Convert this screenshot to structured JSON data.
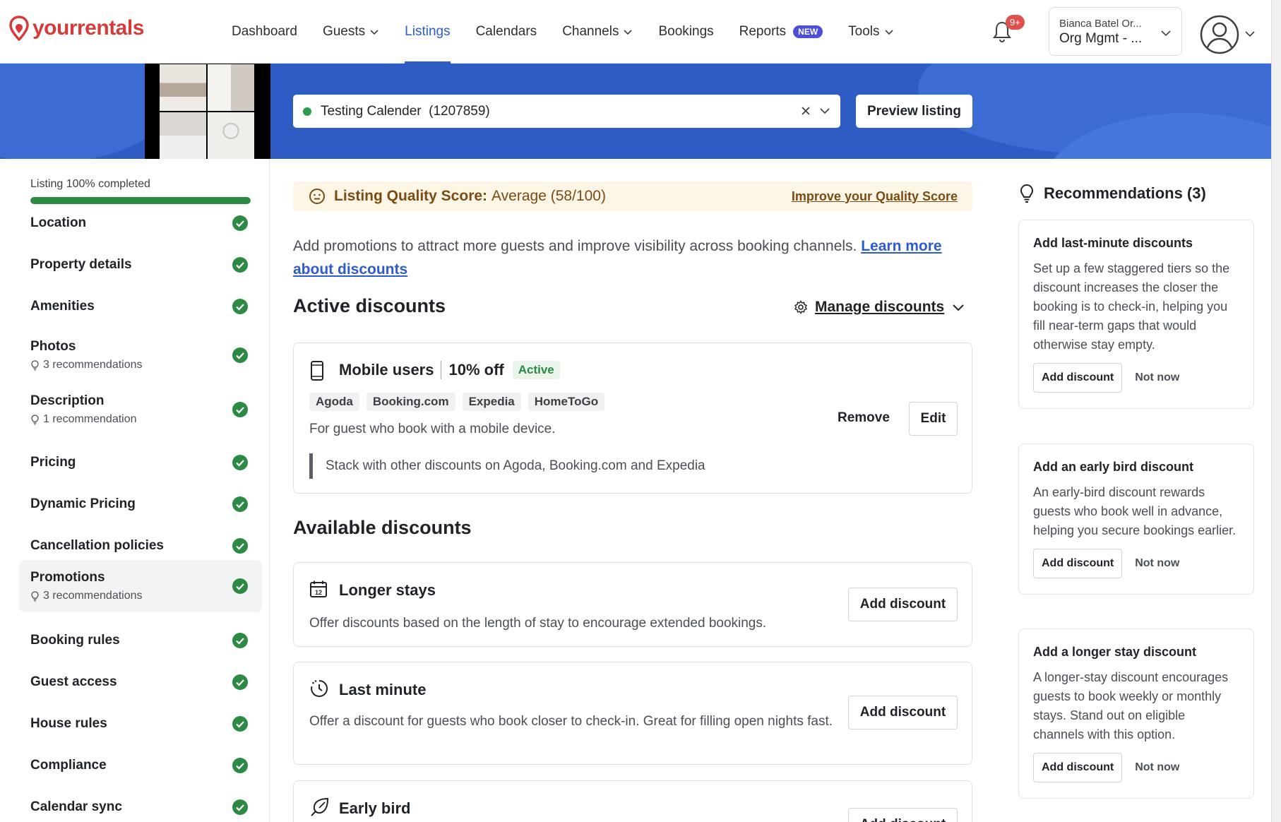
{
  "app": {
    "logo_text": "yourrentals"
  },
  "nav": {
    "items": [
      {
        "label": "Dashboard"
      },
      {
        "label": "Guests"
      },
      {
        "label": "Listings"
      },
      {
        "label": "Calendars"
      },
      {
        "label": "Channels"
      },
      {
        "label": "Bookings"
      },
      {
        "label": "Reports",
        "badge": "NEW"
      },
      {
        "label": "Tools"
      }
    ],
    "notifications_badge": "9+",
    "org": {
      "user": "Bianca Batel Or...",
      "name": "Org Mgmt - ..."
    }
  },
  "listing": {
    "name": "Testing Calender  (1207859)",
    "preview_label": "Preview listing"
  },
  "sidebar": {
    "completion_label": "Listing 100% completed",
    "completion_percent": 100,
    "items": [
      {
        "label": "Location"
      },
      {
        "label": "Property details"
      },
      {
        "label": "Amenities"
      },
      {
        "label": "Photos",
        "sub": "3 recommendations"
      },
      {
        "label": "Description",
        "sub": "1 recommendation"
      },
      {
        "label": "Pricing"
      },
      {
        "label": "Dynamic Pricing"
      },
      {
        "label": "Cancellation policies"
      },
      {
        "label": "Promotions",
        "sub": "3 recommendations"
      },
      {
        "label": "Booking rules"
      },
      {
        "label": "Guest access"
      },
      {
        "label": "House rules"
      },
      {
        "label": "Compliance"
      },
      {
        "label": "Calendar sync"
      }
    ]
  },
  "quality": {
    "label": "Listing Quality Score:",
    "value": "Average (58/100)",
    "link": "Improve your Quality Score"
  },
  "intro": {
    "text": "Add promotions to attract more guests and improve visibility across booking channels. ",
    "link": "Learn more about discounts"
  },
  "active": {
    "heading": "Active discounts",
    "manage_label": "Manage discounts",
    "card": {
      "title": "Mobile users",
      "amount": "10% off",
      "status": "Active",
      "channels": [
        "Agoda",
        "Booking.com",
        "Expedia",
        "HomeToGo"
      ],
      "desc": "For guest who book with a mobile device.",
      "stack_note": "Stack with other discounts on Agoda, Booking.com and Expedia",
      "remove_label": "Remove",
      "edit_label": "Edit"
    }
  },
  "available": {
    "heading": "Available discounts",
    "items": [
      {
        "title": "Longer stays",
        "desc": "Offer discounts based on the length of stay to encourage extended bookings.",
        "button": "Add discount"
      },
      {
        "title": "Last minute",
        "desc": "Offer a discount for guests who book closer to check-in. Great for filling open nights fast.",
        "button": "Add discount"
      },
      {
        "title": "Early bird",
        "button": "Add discount"
      }
    ]
  },
  "recommendations": {
    "heading": "Recommendations (3)",
    "items": [
      {
        "title": "Add last-minute discounts",
        "desc": "Set up a few staggered tiers so the discount increases the closer the booking is to check-in, helping you fill near-term gaps that would otherwise stay empty.",
        "add": "Add discount",
        "dismiss": "Not now"
      },
      {
        "title": "Add an early bird discount",
        "desc": "An early-bird discount rewards guests who book well in advance, helping you secure bookings earlier.",
        "add": "Add discount",
        "dismiss": "Not now"
      },
      {
        "title": "Add a longer stay discount",
        "desc": "A longer-stay discount encourages guests to book weekly or monthly stays. Stand out on eligible channels with this option.",
        "add": "Add discount",
        "dismiss": "Not now"
      }
    ]
  },
  "colors": {
    "brand": "#d63b3b",
    "accent": "#2f5bd0",
    "banner": "#2f5cc4",
    "success": "#2c8a44"
  }
}
